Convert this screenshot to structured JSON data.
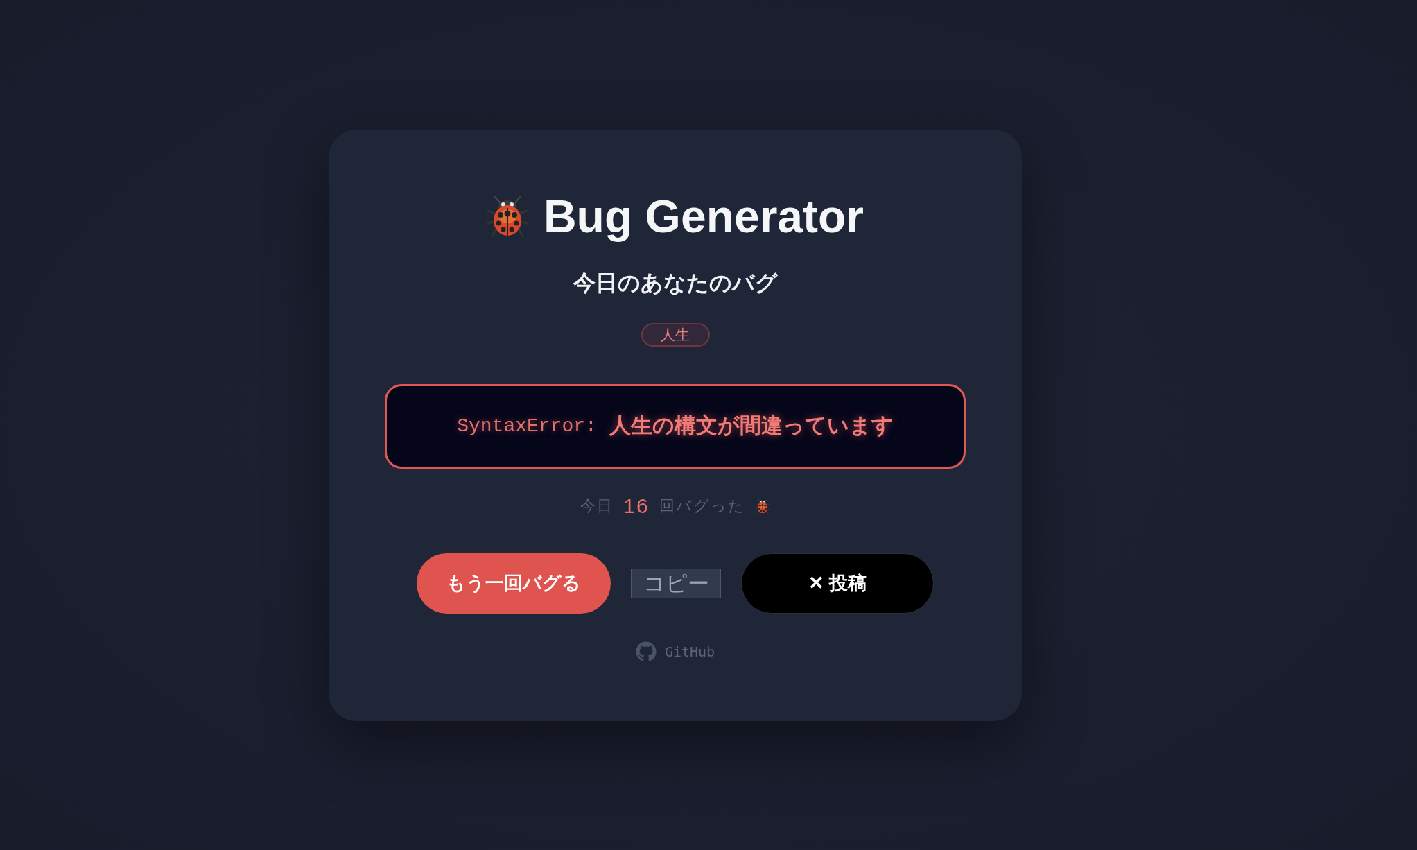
{
  "header": {
    "title": "Bug Generator",
    "subtitle": "今日のあなたのバグ"
  },
  "tag": {
    "label": "人生"
  },
  "error": {
    "type": "SyntaxError:",
    "message": "人生の構文が間違っています"
  },
  "counter": {
    "prefix": "今日",
    "count": "16",
    "suffix": "回バグった"
  },
  "buttons": [
    {
      "kind": "primary",
      "label": "もう一回バグる"
    },
    {
      "kind": "plain",
      "label": "コピー"
    },
    {
      "kind": "dark",
      "label": "✕ 投稿"
    }
  ],
  "footer": {
    "link": "GitHub"
  }
}
